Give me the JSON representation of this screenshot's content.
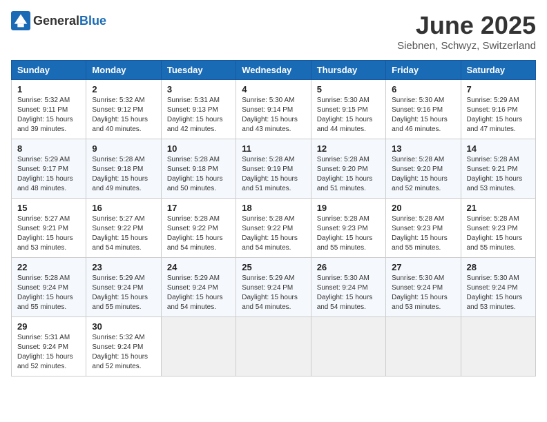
{
  "header": {
    "logo_general": "General",
    "logo_blue": "Blue",
    "month": "June 2025",
    "location": "Siebnen, Schwyz, Switzerland"
  },
  "weekdays": [
    "Sunday",
    "Monday",
    "Tuesday",
    "Wednesday",
    "Thursday",
    "Friday",
    "Saturday"
  ],
  "weeks": [
    [
      {
        "day": "1",
        "info": "Sunrise: 5:32 AM\nSunset: 9:11 PM\nDaylight: 15 hours\nand 39 minutes."
      },
      {
        "day": "2",
        "info": "Sunrise: 5:32 AM\nSunset: 9:12 PM\nDaylight: 15 hours\nand 40 minutes."
      },
      {
        "day": "3",
        "info": "Sunrise: 5:31 AM\nSunset: 9:13 PM\nDaylight: 15 hours\nand 42 minutes."
      },
      {
        "day": "4",
        "info": "Sunrise: 5:30 AM\nSunset: 9:14 PM\nDaylight: 15 hours\nand 43 minutes."
      },
      {
        "day": "5",
        "info": "Sunrise: 5:30 AM\nSunset: 9:15 PM\nDaylight: 15 hours\nand 44 minutes."
      },
      {
        "day": "6",
        "info": "Sunrise: 5:30 AM\nSunset: 9:16 PM\nDaylight: 15 hours\nand 46 minutes."
      },
      {
        "day": "7",
        "info": "Sunrise: 5:29 AM\nSunset: 9:16 PM\nDaylight: 15 hours\nand 47 minutes."
      }
    ],
    [
      {
        "day": "8",
        "info": "Sunrise: 5:29 AM\nSunset: 9:17 PM\nDaylight: 15 hours\nand 48 minutes."
      },
      {
        "day": "9",
        "info": "Sunrise: 5:28 AM\nSunset: 9:18 PM\nDaylight: 15 hours\nand 49 minutes."
      },
      {
        "day": "10",
        "info": "Sunrise: 5:28 AM\nSunset: 9:18 PM\nDaylight: 15 hours\nand 50 minutes."
      },
      {
        "day": "11",
        "info": "Sunrise: 5:28 AM\nSunset: 9:19 PM\nDaylight: 15 hours\nand 51 minutes."
      },
      {
        "day": "12",
        "info": "Sunrise: 5:28 AM\nSunset: 9:20 PM\nDaylight: 15 hours\nand 51 minutes."
      },
      {
        "day": "13",
        "info": "Sunrise: 5:28 AM\nSunset: 9:20 PM\nDaylight: 15 hours\nand 52 minutes."
      },
      {
        "day": "14",
        "info": "Sunrise: 5:28 AM\nSunset: 9:21 PM\nDaylight: 15 hours\nand 53 minutes."
      }
    ],
    [
      {
        "day": "15",
        "info": "Sunrise: 5:27 AM\nSunset: 9:21 PM\nDaylight: 15 hours\nand 53 minutes."
      },
      {
        "day": "16",
        "info": "Sunrise: 5:27 AM\nSunset: 9:22 PM\nDaylight: 15 hours\nand 54 minutes."
      },
      {
        "day": "17",
        "info": "Sunrise: 5:28 AM\nSunset: 9:22 PM\nDaylight: 15 hours\nand 54 minutes."
      },
      {
        "day": "18",
        "info": "Sunrise: 5:28 AM\nSunset: 9:22 PM\nDaylight: 15 hours\nand 54 minutes."
      },
      {
        "day": "19",
        "info": "Sunrise: 5:28 AM\nSunset: 9:23 PM\nDaylight: 15 hours\nand 55 minutes."
      },
      {
        "day": "20",
        "info": "Sunrise: 5:28 AM\nSunset: 9:23 PM\nDaylight: 15 hours\nand 55 minutes."
      },
      {
        "day": "21",
        "info": "Sunrise: 5:28 AM\nSunset: 9:23 PM\nDaylight: 15 hours\nand 55 minutes."
      }
    ],
    [
      {
        "day": "22",
        "info": "Sunrise: 5:28 AM\nSunset: 9:24 PM\nDaylight: 15 hours\nand 55 minutes."
      },
      {
        "day": "23",
        "info": "Sunrise: 5:29 AM\nSunset: 9:24 PM\nDaylight: 15 hours\nand 55 minutes."
      },
      {
        "day": "24",
        "info": "Sunrise: 5:29 AM\nSunset: 9:24 PM\nDaylight: 15 hours\nand 54 minutes."
      },
      {
        "day": "25",
        "info": "Sunrise: 5:29 AM\nSunset: 9:24 PM\nDaylight: 15 hours\nand 54 minutes."
      },
      {
        "day": "26",
        "info": "Sunrise: 5:30 AM\nSunset: 9:24 PM\nDaylight: 15 hours\nand 54 minutes."
      },
      {
        "day": "27",
        "info": "Sunrise: 5:30 AM\nSunset: 9:24 PM\nDaylight: 15 hours\nand 53 minutes."
      },
      {
        "day": "28",
        "info": "Sunrise: 5:30 AM\nSunset: 9:24 PM\nDaylight: 15 hours\nand 53 minutes."
      }
    ],
    [
      {
        "day": "29",
        "info": "Sunrise: 5:31 AM\nSunset: 9:24 PM\nDaylight: 15 hours\nand 52 minutes."
      },
      {
        "day": "30",
        "info": "Sunrise: 5:32 AM\nSunset: 9:24 PM\nDaylight: 15 hours\nand 52 minutes."
      },
      {
        "day": "",
        "info": ""
      },
      {
        "day": "",
        "info": ""
      },
      {
        "day": "",
        "info": ""
      },
      {
        "day": "",
        "info": ""
      },
      {
        "day": "",
        "info": ""
      }
    ]
  ]
}
